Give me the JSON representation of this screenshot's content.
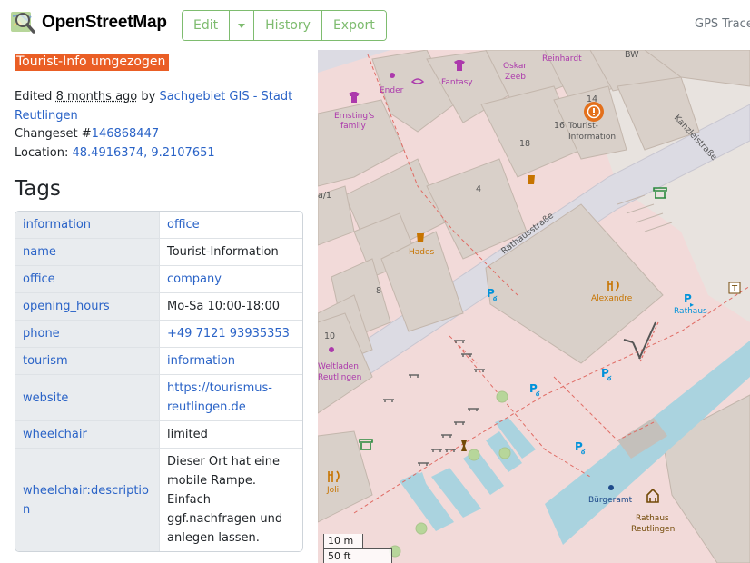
{
  "header": {
    "brand": "OpenStreetMap",
    "nav": {
      "edit": "Edit",
      "history": "History",
      "export": "Export"
    },
    "gps": "GPS Traces"
  },
  "feature": {
    "title": "Tourist-Info umgezogen",
    "edited_prefix": "Edited ",
    "edited_time": "8 months ago",
    "edited_by": " by ",
    "editor": "Sachgebiet GIS - Stadt Reutlingen",
    "changeset_label": "Changeset #",
    "changeset_id": "146868447",
    "location_label": "Location: ",
    "location": "48.4916374, 9.2107651"
  },
  "tags": {
    "heading": "Tags",
    "rows": [
      {
        "key": "information",
        "value": "office",
        "value_is_link": true
      },
      {
        "key": "name",
        "value": "Tourist-Information",
        "value_is_link": false
      },
      {
        "key": "office",
        "value": "company",
        "value_is_link": true
      },
      {
        "key": "opening_hours",
        "value": "Mo-Sa 10:00-18:00",
        "value_is_link": false
      },
      {
        "key": "phone",
        "value": "+49 7121 93935353",
        "value_is_link": true
      },
      {
        "key": "tourism",
        "value": "information",
        "value_is_link": true
      },
      {
        "key": "website",
        "value": "https://tourismus-reutlingen.de",
        "value_is_link": true
      },
      {
        "key": "wheelchair",
        "value": "limited",
        "value_is_link": false
      },
      {
        "key": "wheelchair:description",
        "value": "Dieser Ort hat eine mobile Rampe. Einfach ggf.nachfragen und anlegen lassen.",
        "value_is_link": false
      }
    ]
  },
  "map": {
    "labels": {
      "bw": "BW",
      "reinhardt": "Reinhardt",
      "oskar": "Oskar",
      "zeeb": "Zeeb",
      "ender": "Ender",
      "fantasy": "Fantasy",
      "ernstings": "Ernsting's",
      "family": "family",
      "n14": "14",
      "n16": "16",
      "n18": "18",
      "n4": "4",
      "n8": "8",
      "n10": "10",
      "n_partial": "a/1",
      "tourist1": "Tourist-",
      "tourist2": "Information",
      "kanzlei": "Kanzleistraße",
      "rathausstr": "Rathausstraße",
      "hades": "Hades",
      "alexandre": "Alexandre",
      "rathaus": "Rathaus",
      "weltladen": "Weltladen",
      "reutlingen_l": "Reutlingen",
      "joli": "Joli",
      "buergeramt": "Bürgeramt",
      "rathaus2": "Rathaus",
      "reutlingen2": "Reutlingen"
    },
    "scale": {
      "metric": "10 m",
      "imperial": "50 ft"
    }
  },
  "colors": {
    "accent": "#7ebc6f",
    "title_bg": "#ea5e25",
    "link": "#2a63c7",
    "map_pedestrian": "#f2dad9",
    "map_building": "#d9d0c9",
    "map_water": "#aad3df",
    "poi_shop": "#ac39ac",
    "poi_food": "#c77400",
    "poi_tourism": "#e3701c",
    "parking": "#0092da"
  }
}
